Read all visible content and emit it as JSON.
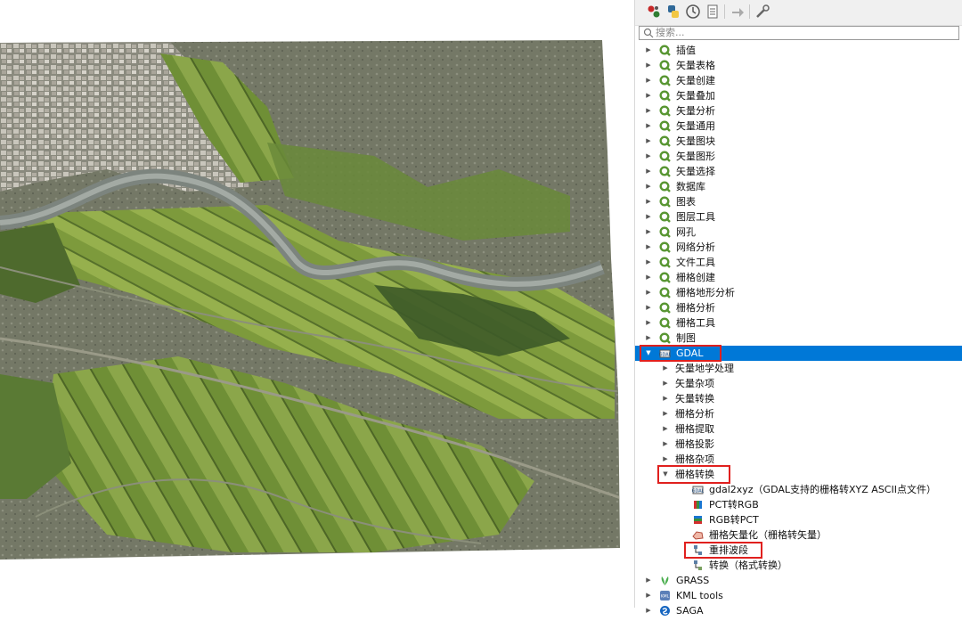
{
  "toolbar": {
    "buttons": [
      {
        "name": "models-icon",
        "color": "#c62828"
      },
      {
        "name": "python-icon",
        "color": "#306998"
      },
      {
        "name": "history-icon",
        "color": "#555555"
      },
      {
        "name": "results-icon",
        "color": "#666666"
      },
      {
        "name": "edit-in-place-icon",
        "color": "#888888"
      },
      {
        "name": "options-icon",
        "color": "#666666"
      }
    ]
  },
  "search": {
    "placeholder": "搜索..."
  },
  "colors": {
    "selection": "#0078d7",
    "highlight": "#e0201e",
    "qgis_green": "#589632"
  },
  "tree": {
    "top_groups": [
      {
        "label": "插值"
      },
      {
        "label": "矢量表格"
      },
      {
        "label": "矢量创建"
      },
      {
        "label": "矢量叠加"
      },
      {
        "label": "矢量分析"
      },
      {
        "label": "矢量通用"
      },
      {
        "label": "矢量图块"
      },
      {
        "label": "矢量图形"
      },
      {
        "label": "矢量选择"
      },
      {
        "label": "数据库"
      },
      {
        "label": "图表"
      },
      {
        "label": "图层工具"
      },
      {
        "label": "网孔"
      },
      {
        "label": "网络分析"
      },
      {
        "label": "文件工具"
      },
      {
        "label": "栅格创建"
      },
      {
        "label": "栅格地形分析"
      },
      {
        "label": "栅格分析"
      },
      {
        "label": "栅格工具"
      },
      {
        "label": "制图"
      }
    ],
    "gdal": {
      "label": "GDAL",
      "selected": true,
      "subgroups": [
        {
          "label": "矢量地学处理"
        },
        {
          "label": "矢量杂项"
        },
        {
          "label": "矢量转换"
        },
        {
          "label": "栅格分析"
        },
        {
          "label": "栅格提取"
        },
        {
          "label": "栅格投影"
        },
        {
          "label": "栅格杂项"
        }
      ],
      "raster_conversion": {
        "label": "栅格转换",
        "tools": [
          {
            "label": "gdal2xyz（GDAL支持的栅格转XYZ ASCII点文件）",
            "icon": "gdal-icon"
          },
          {
            "label": "PCT转RGB",
            "icon": "pct-rgb-icon"
          },
          {
            "label": "RGB转PCT",
            "icon": "rgb-pct-icon"
          },
          {
            "label": "栅格矢量化（栅格转矢量）",
            "icon": "polygonize-icon"
          },
          {
            "label": "重排波段",
            "icon": "rearrange-bands-icon"
          },
          {
            "label": "转换（格式转换）",
            "icon": "translate-icon"
          }
        ]
      }
    },
    "providers": [
      {
        "label": "GRASS",
        "icon": "grass-icon"
      },
      {
        "label": "KML tools",
        "icon": "kml-icon"
      },
      {
        "label": "SAGA",
        "icon": "saga-icon"
      }
    ]
  }
}
